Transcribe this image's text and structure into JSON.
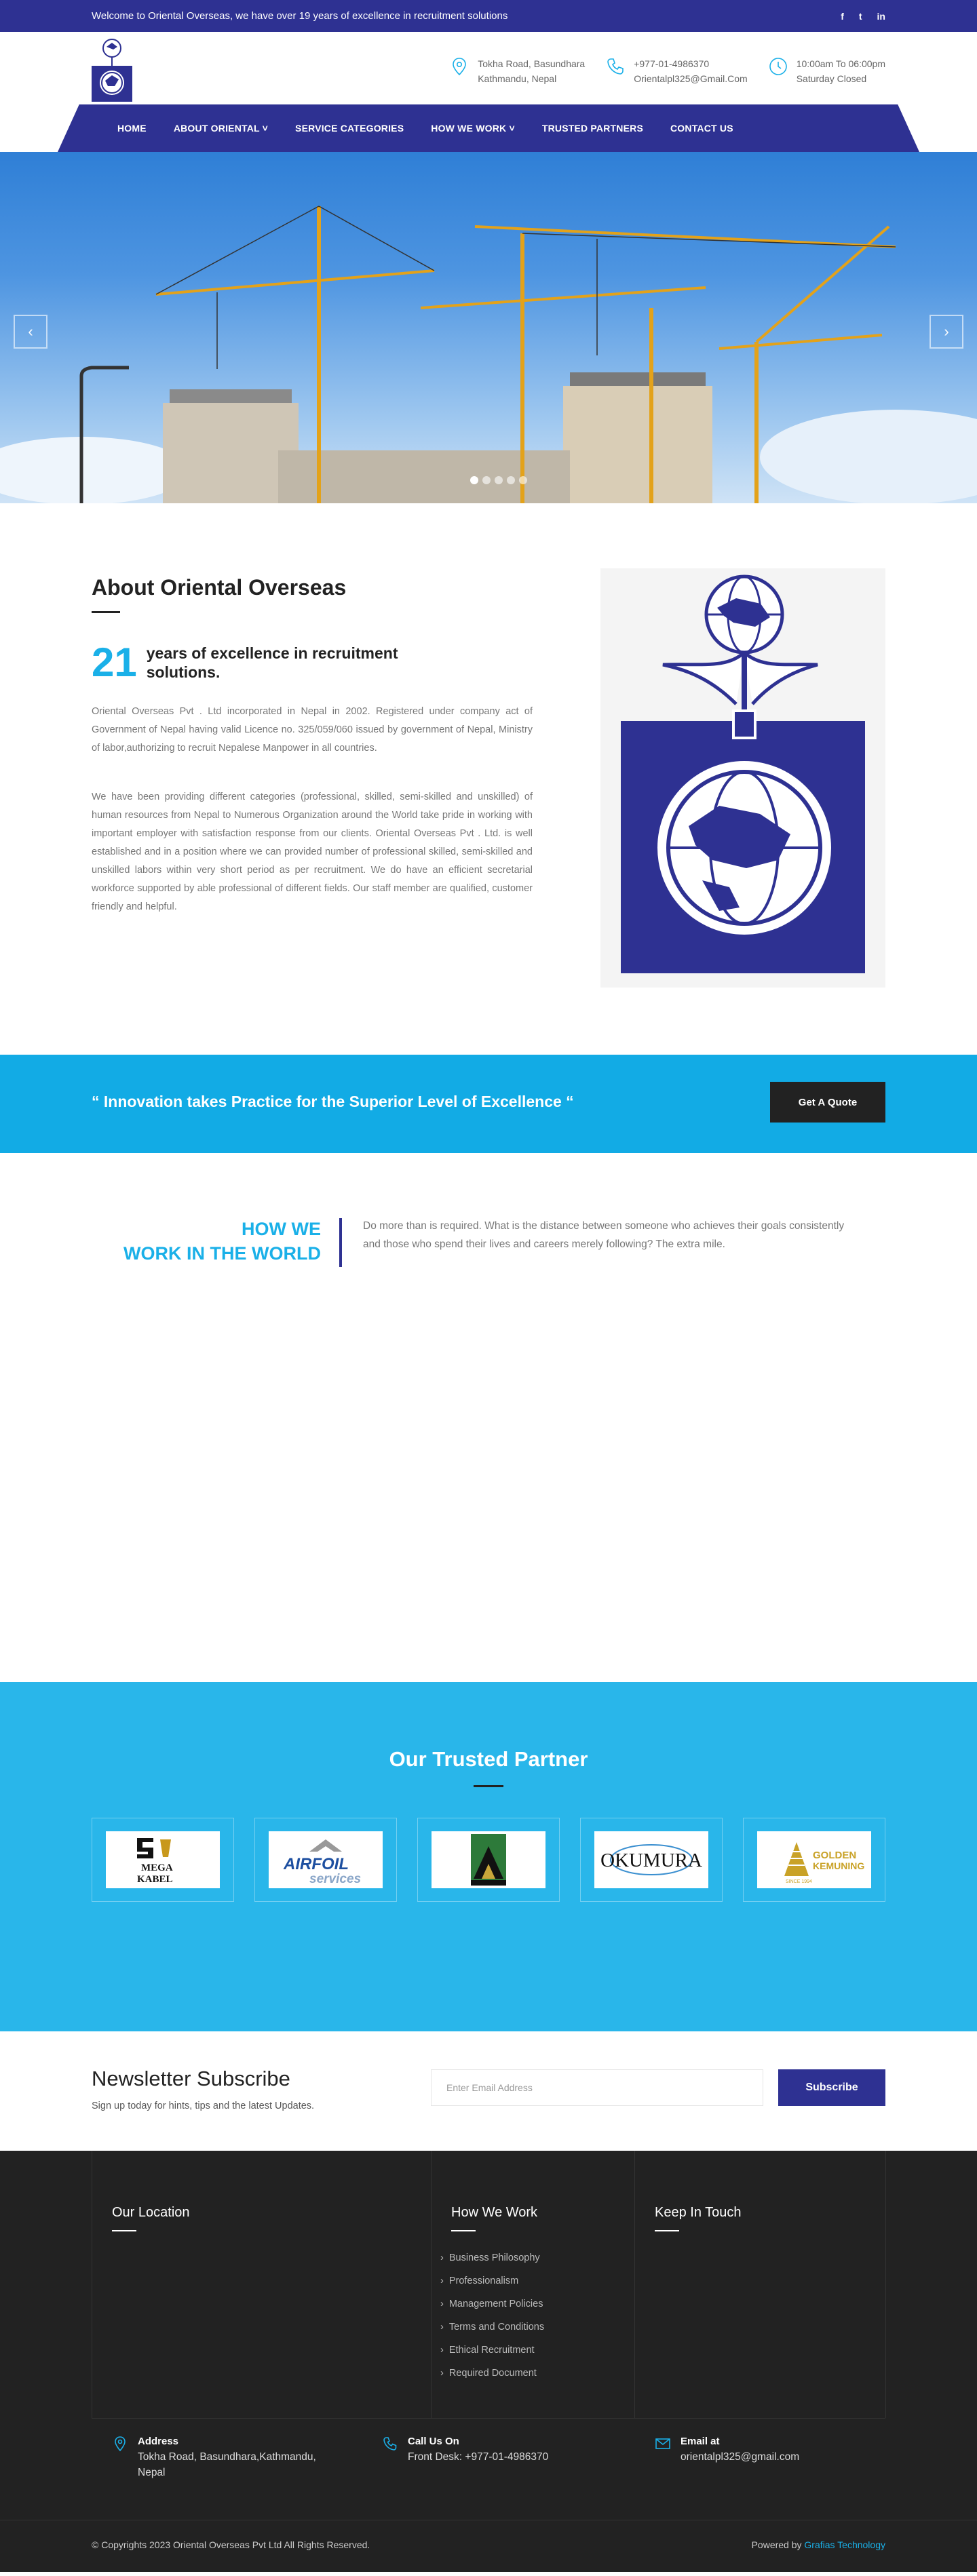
{
  "topbar": {
    "welcome": "Welcome to Oriental Overseas, we have over 19 years of excellence in recruitment solutions",
    "social": [
      "f",
      "t",
      "in"
    ]
  },
  "header": {
    "address_l1": "Tokha Road, Basundhara",
    "address_l2": "Kathmandu, Nepal",
    "phone": "+977-01-4986370",
    "email": "Orientalpl325@Gmail.Com",
    "hours_l1": "10:00am To 06:00pm",
    "hours_l2": "Saturday Closed"
  },
  "nav": {
    "items": [
      "HOME",
      "ABOUT ORIENTAL",
      "SERVICE CATEGORIES",
      "HOW WE WORK",
      "TRUSTED PARTNERS",
      "CONTACT US"
    ]
  },
  "hero": {
    "prev": "‹",
    "next": "›",
    "slide_count": 5,
    "active_slide": 1
  },
  "about": {
    "title": "About Oriental Overseas",
    "years_num": "21",
    "years_text": "years of excellence in recruitment solutions.",
    "p1": "Oriental Overseas Pvt . Ltd incorporated in Nepal in 2002. Registered under company act of Government of Nepal having valid Licence no. 325/059/060 issued by government of Nepal, Ministry of labor,authorizing to recruit Nepalese Manpower in all countries.",
    "p2": "We have been providing different categories (professional, skilled, semi-skilled and unskilled) of human resources from Nepal to Numerous Organization around the World take pride in working with important employer with satisfaction response from our clients. Oriental Overseas Pvt . Ltd. is well established and in a position where we can provided number of professional skilled, semi-skilled and unskilled labors within very short period as per recruitment. We do have an efficient secretarial workforce supported by able professional of different fields. Our staff member are qualified, customer friendly and helpful."
  },
  "quote": {
    "text": "“ Innovation takes Practice for the Superior Level of Excellence “",
    "button": "Get A Quote"
  },
  "how": {
    "title_l1": "HOW WE",
    "title_l2": "WORK IN THE WORLD",
    "text": "Do more than is required. What is the distance between someone who achieves their goals consistently and those who spend their lives and careers merely following? The extra mile."
  },
  "partners": {
    "title": "Our Trusted Partner",
    "logos": [
      {
        "l1": "MEGA",
        "l2": "KABEL"
      },
      {
        "l1": "AIRFOIL",
        "l2": "services"
      },
      {
        "l1": ""
      },
      {
        "l1": "OKUMURA"
      },
      {
        "l1": "GOLDEN",
        "l2": "KEMUNING",
        "l3": "SINCE 1994"
      }
    ]
  },
  "newsletter": {
    "title": "Newsletter Subscribe",
    "subtitle": "Sign up today for hints, tips and the latest Updates.",
    "placeholder": "Enter Email Address",
    "button": "Subscribe"
  },
  "footer": {
    "col1_title": "Our Location",
    "col2_title": "How We Work",
    "col2_links": [
      "Business Philosophy",
      "Professionalism",
      "Management Policies",
      "Terms and Conditions",
      "Ethical Recruitment",
      "Required Document"
    ],
    "col3_title": "Keep In Touch",
    "address_title": "Address",
    "address_l1": "Tokha Road, Basundhara,Kathmandu,",
    "address_l2": "Nepal",
    "call_title": "Call Us On",
    "call_value": "Front Desk: +977-01-4986370",
    "email_title": "Email at",
    "email_value": "orientalpl325@gmail.com",
    "copyright": "© Copyrights 2023 Oriental Overseas Pvt Ltd All Rights Reserved.",
    "powered_prefix": "Powered by ",
    "powered_by": "Grafias Technology"
  }
}
